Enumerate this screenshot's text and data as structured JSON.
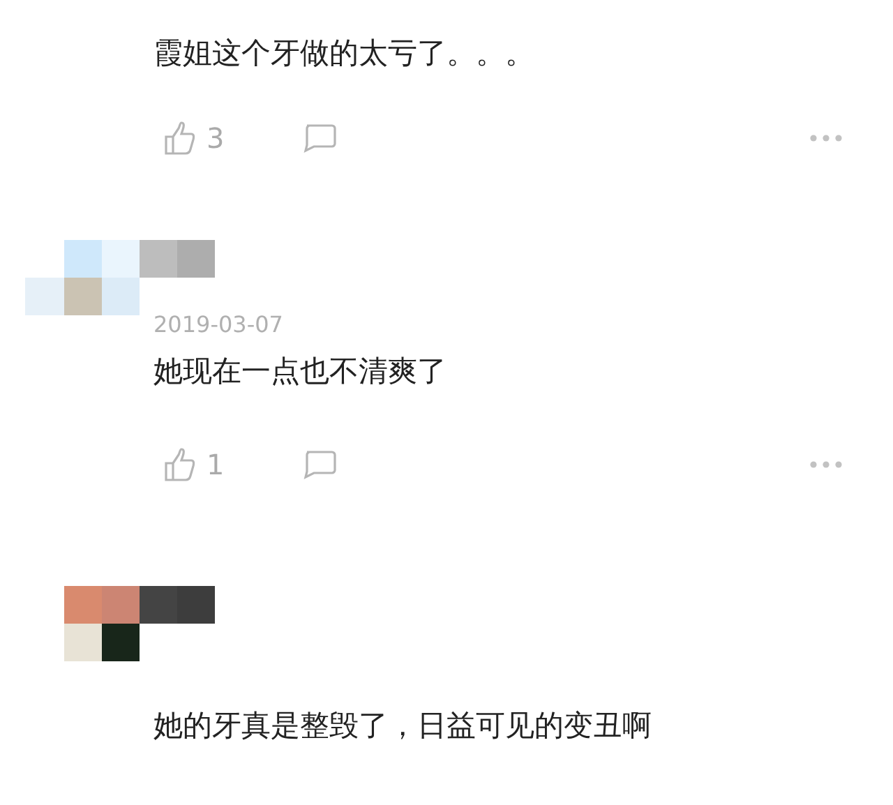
{
  "comments": [
    {
      "text": "霞姐这个牙做的太亏了。。。",
      "likes": "3"
    },
    {
      "date": "2019-03-07",
      "text": "她现在一点也不清爽了",
      "likes": "1"
    },
    {
      "text": "她的牙真是整毁了，日益可见的变丑啊"
    }
  ]
}
